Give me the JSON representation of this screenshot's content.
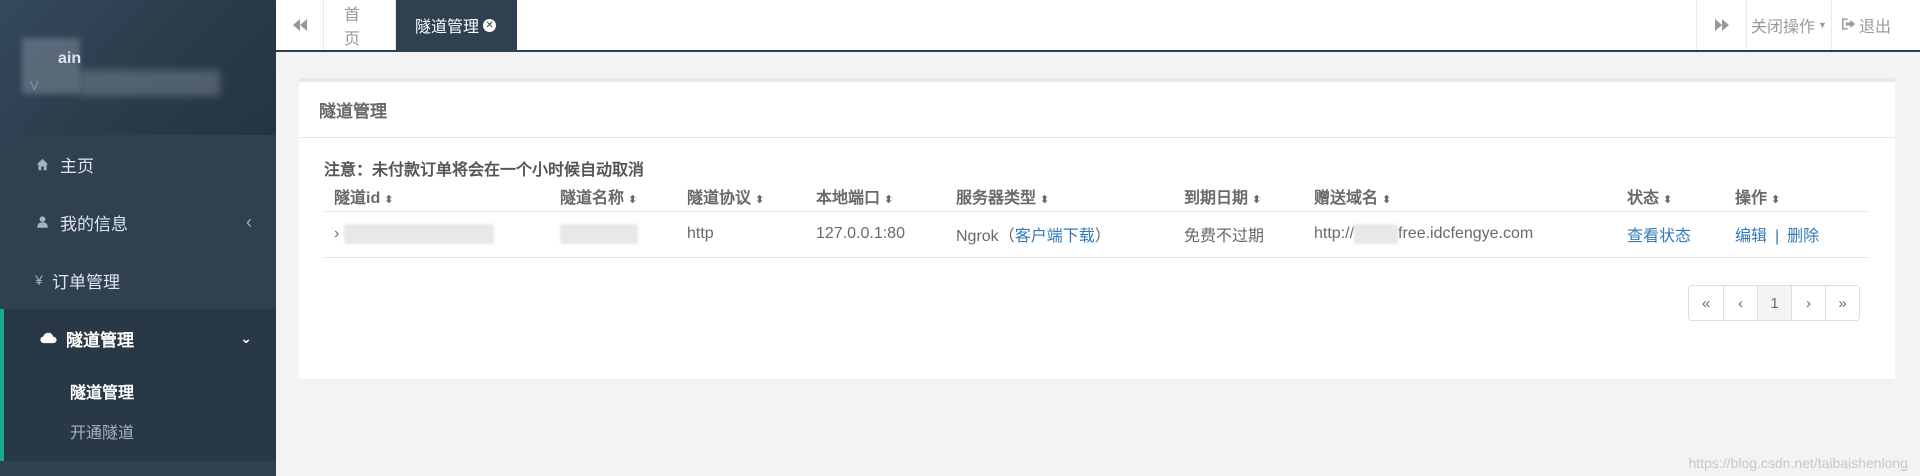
{
  "sidebar": {
    "profile": {
      "name": "ain",
      "meta": "V"
    },
    "items": [
      {
        "label": "主页",
        "icon": "home-icon"
      },
      {
        "label": "我的信息",
        "icon": "user-icon"
      },
      {
        "label": "订单管理",
        "icon": "yen-icon"
      },
      {
        "label": "隧道管理",
        "icon": "cloud-icon"
      }
    ],
    "subitems": [
      {
        "label": "隧道管理"
      },
      {
        "label": "开通隧道"
      }
    ]
  },
  "topbar": {
    "tabs": [
      {
        "label": "首页"
      },
      {
        "label": "隧道管理"
      }
    ],
    "close_ops": "关闭操作",
    "exit": "退出"
  },
  "main": {
    "title": "隧道管理",
    "notice": "注意：未付款订单将会在一个小时候自动取消",
    "columns": [
      "隧道id",
      "隧道名称",
      "隧道协议",
      "本地端口",
      "服务器类型",
      "到期日期",
      "赠送域名",
      "状态",
      "操作"
    ],
    "rows": [
      {
        "id_prefix": "›",
        "protocol": "http",
        "local_port": "127.0.0.1:80",
        "server_type": "Ngrok",
        "download_open": "（",
        "download_link": "客户端下载",
        "download_close": "）",
        "expire": "免费不过期",
        "domain_prefix": "http://",
        "domain_suffix": "free.idcfengye.com",
        "status_link": "查看状态",
        "edit": "编辑",
        "sep": "|",
        "delete": "删除"
      }
    ]
  },
  "pagination": {
    "first": "«",
    "prev": "‹",
    "current": "1",
    "next": "›",
    "last": "»"
  },
  "watermark": "https://blog.csdn.net/taibaishenlong",
  "colors": {
    "sidebar_bg": "#2f4050",
    "accent": "#19aa8d",
    "link": "#337ab7"
  }
}
